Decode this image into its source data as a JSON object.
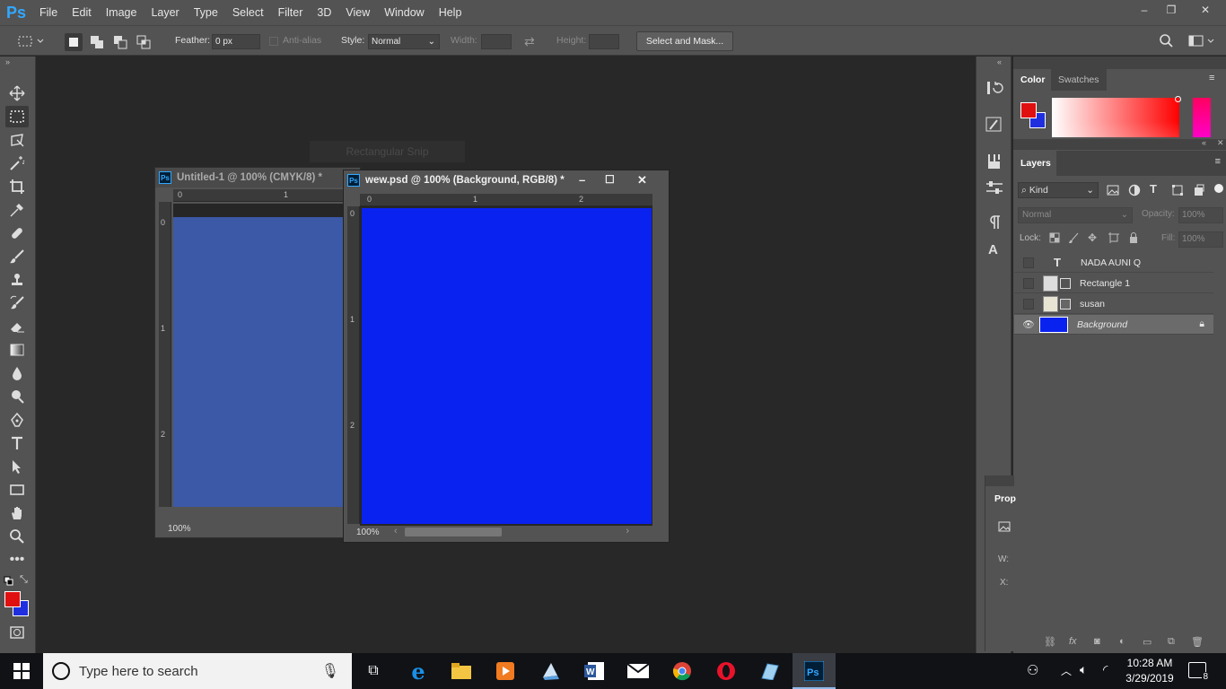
{
  "app": {
    "logo": "Ps"
  },
  "menu": [
    "File",
    "Edit",
    "Image",
    "Layer",
    "Type",
    "Select",
    "Filter",
    "3D",
    "View",
    "Window",
    "Help"
  ],
  "window_controls": {
    "minimize": "–",
    "restore": "❐",
    "close": "✕"
  },
  "options": {
    "feather_label": "Feather:",
    "feather_value": "0 px",
    "antialias_label": "Anti-alias",
    "style_label": "Style:",
    "style_value": "Normal",
    "width_label": "Width:",
    "height_label": "Height:",
    "select_mask_label": "Select and Mask..."
  },
  "snip_overlay": "Rectangular Snip",
  "doc1": {
    "title": "Untitled-1 @ 100% (CMYK/8) *",
    "zoom": "100%",
    "ruler_h": [
      "0",
      "1"
    ],
    "ruler_v": [
      "0",
      "1",
      "2"
    ],
    "canvas_color": "#3b59a6"
  },
  "doc2": {
    "title": "wew.psd @ 100% (Background, RGB/8) *",
    "zoom": "100%",
    "ruler_h": [
      "0",
      "1",
      "2"
    ],
    "ruler_v": [
      "0",
      "1",
      "2"
    ],
    "canvas_color": "#0a22f0"
  },
  "color_panel": {
    "tabs": [
      "Color",
      "Swatches"
    ],
    "foreground": "#e01010",
    "background": "#1f2fe0"
  },
  "layers_panel": {
    "tab": "Layers",
    "kind_label": "Kind",
    "blend_mode": "Normal",
    "opacity_label": "Opacity:",
    "opacity_value": "100%",
    "lock_label": "Lock:",
    "fill_label": "Fill:",
    "fill_value": "100%",
    "layers": [
      {
        "name": "NADA AUNI Q",
        "type": "text",
        "visible": false
      },
      {
        "name": "Rectangle 1",
        "type": "shape",
        "visible": false
      },
      {
        "name": "susan",
        "type": "smart",
        "visible": false
      },
      {
        "name": "Background",
        "type": "background",
        "visible": true,
        "locked": true,
        "selected": true
      }
    ]
  },
  "properties_panel": {
    "tab": "Prop",
    "w_label": "W:",
    "x_label": "X:"
  },
  "taskbar": {
    "search_placeholder": "Type here to search",
    "time": "10:28 AM",
    "date": "3/29/2019",
    "notification_count": "8"
  }
}
